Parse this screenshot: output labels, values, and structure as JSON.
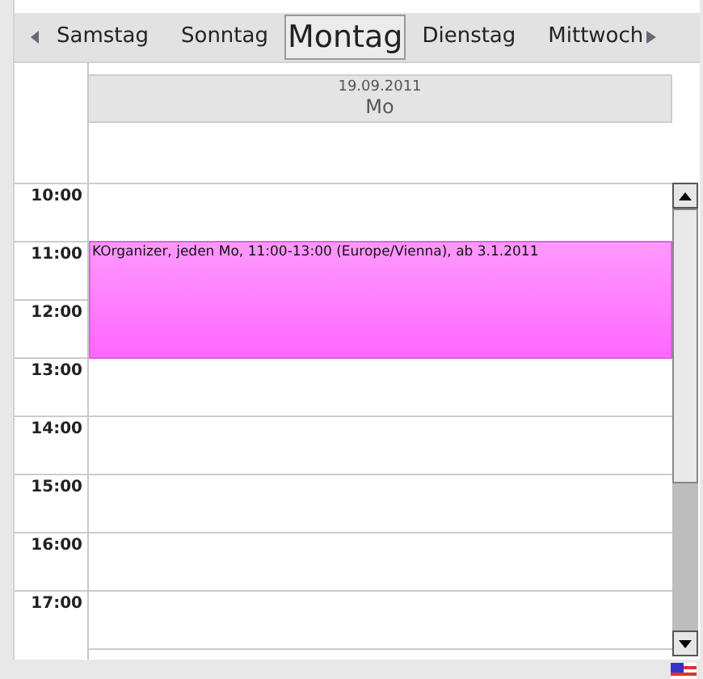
{
  "day_tabs": [
    {
      "label": "Samstag",
      "selected": false
    },
    {
      "label": "Sonntag",
      "selected": false
    },
    {
      "label": "Montag",
      "selected": true
    },
    {
      "label": "Dienstag",
      "selected": false
    },
    {
      "label": "Mittwoch",
      "selected": false
    }
  ],
  "day_header": {
    "date": "19.09.2011",
    "weekday": "Mo"
  },
  "hours": [
    "10:00",
    "11:00",
    "12:00",
    "13:00",
    "14:00",
    "15:00",
    "16:00",
    "17:00"
  ],
  "events": [
    {
      "title": "KOrganizer, jeden Mo, 11:00-13:00 (Europe/Vienna), ab 3.1.2011",
      "color": "#ff66ff"
    }
  ]
}
